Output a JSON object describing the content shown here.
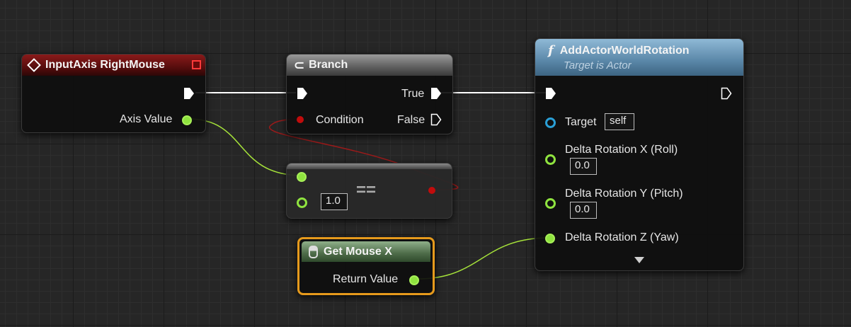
{
  "nodes": {
    "input_axis": {
      "title": "InputAxis RightMouse",
      "axis_value_label": "Axis Value"
    },
    "branch": {
      "title": "Branch",
      "true_label": "True",
      "false_label": "False",
      "condition_label": "Condition"
    },
    "equals": {
      "operator": "==",
      "value": "1.0"
    },
    "add_rotation": {
      "title": "AddActorWorldRotation",
      "subtitle": "Target is Actor",
      "target_label": "Target",
      "target_value": "self",
      "delta_x_label": "Delta Rotation X (Roll)",
      "delta_x_value": "0.0",
      "delta_y_label": "Delta Rotation Y (Pitch)",
      "delta_y_value": "0.0",
      "delta_z_label": "Delta Rotation Z (Yaw)"
    },
    "get_mouse_x": {
      "title": "Get Mouse X",
      "return_label": "Return Value"
    }
  },
  "colors": {
    "exec_wire": "#ffffff",
    "float_wire": "#a6e33a",
    "bool_wire": "#9c1a1a",
    "selected_outline": "#e69a1c"
  }
}
